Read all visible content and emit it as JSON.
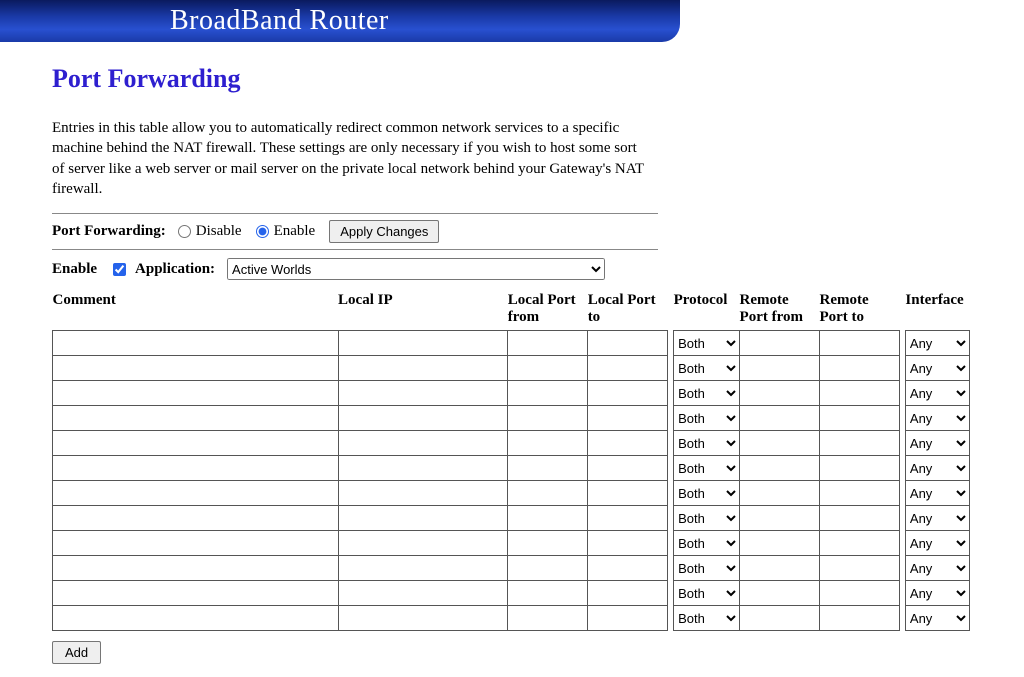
{
  "header": {
    "title": "BroadBand Router"
  },
  "page": {
    "title": "Port Forwarding",
    "description": "Entries in this table allow you to automatically redirect common network services to a specific machine behind the NAT firewall. These settings are only necessary if you wish to host some sort of server like a web server or mail server on the private local network behind your Gateway's NAT firewall."
  },
  "controls": {
    "port_forwarding_label": "Port Forwarding:",
    "disable_label": "Disable",
    "enable_label": "Enable",
    "apply_changes_label": "Apply Changes",
    "selected_mode": "enable",
    "enable_checkbox_label": "Enable",
    "enable_checked": true,
    "application_label": "Application:",
    "application_selected": "Active Worlds",
    "add_label": "Add"
  },
  "table": {
    "headers": {
      "comment": "Comment",
      "local_ip": "Local IP",
      "local_port_from": "Local Port from",
      "local_port_to": "Local Port to",
      "protocol": "Protocol",
      "remote_port_from": "Remote Port from",
      "remote_port_to": "Remote Port to",
      "interface": "Interface"
    },
    "default_protocol": "Both",
    "default_interface": "Any",
    "row_count": 12
  }
}
